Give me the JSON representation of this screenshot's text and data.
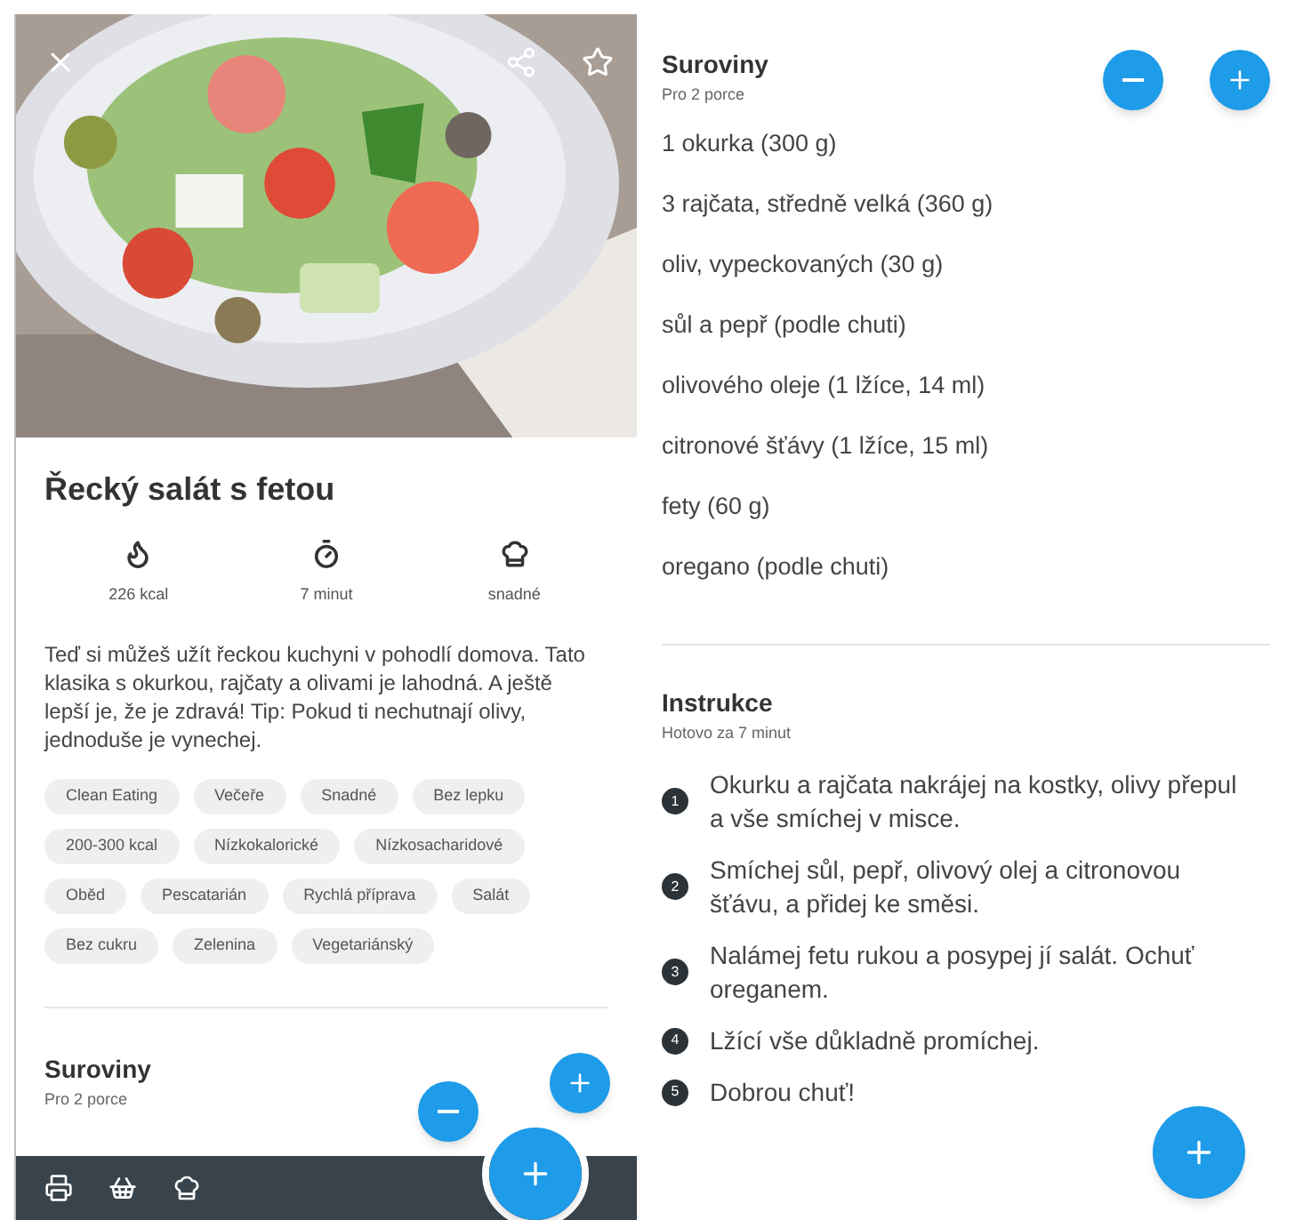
{
  "left": {
    "photo": {
      "kind": "picture"
    },
    "title": "Řecký salát s fetou",
    "stats": [
      {
        "kind": "calories",
        "label": "226 kcal"
      },
      {
        "kind": "time",
        "label": "7 minut"
      },
      {
        "kind": "difficulty",
        "label": "snadné"
      }
    ],
    "description": "Teď si můžeš užít řeckou kuchyni v pohodlí domova. Tato klasika s okurkou, rajčaty a olivami je lahodná. A ještě lepší je, že je zdravá! Tip: Pokud ti nechutnají olivy, jednoduše je vynechej.",
    "tags": [
      [
        "Clean Eating",
        "Večeře",
        "Snadné",
        "Bez lepku"
      ],
      [
        "200-300 kcal",
        "Nízkokalorické",
        "Nízkosacharidové"
      ],
      [
        "Oběd",
        "Pescatarián",
        "Rychlá příprava",
        "Salát"
      ],
      [
        "Bez cukru",
        "Zelenina",
        "Vegetariánský"
      ]
    ],
    "ingredients": {
      "title": "Suroviny",
      "subtitle": "Pro 2 porce"
    }
  },
  "right": {
    "ingredients": {
      "title": "Suroviny",
      "subtitle": "Pro 2 porce",
      "items": [
        "1 okurka (300 g)",
        "3 rajčata, středně velká (360 g)",
        "oliv, vypeckovaných (30 g)",
        "sůl a pepř (podle chuti)",
        "olivového oleje (1 lžíce, 14 ml)",
        "citronové šťávy (1 lžíce, 15 ml)",
        "fety (60 g)",
        "oregano (podle chuti)"
      ]
    },
    "instructions": {
      "title": "Instrukce",
      "subtitle": "Hotovo za 7 minut",
      "steps": [
        {
          "number": "1",
          "text": "Okurku a rajčata nakrájej na kostky, olivy přepul a vše smíchej v misce."
        },
        {
          "number": "2",
          "text": "Smíchej sůl, pepř, olivový olej a citronovou šťávu, a přidej ke směsi."
        },
        {
          "number": "3",
          "text": "Nalámej fetu rukou a posypej jí salát. Ochuť oreganem."
        },
        {
          "number": "4",
          "text": "Lžící vše důkladně promíchej."
        },
        {
          "number": "5",
          "text": "Dobrou chuť!"
        }
      ]
    }
  }
}
